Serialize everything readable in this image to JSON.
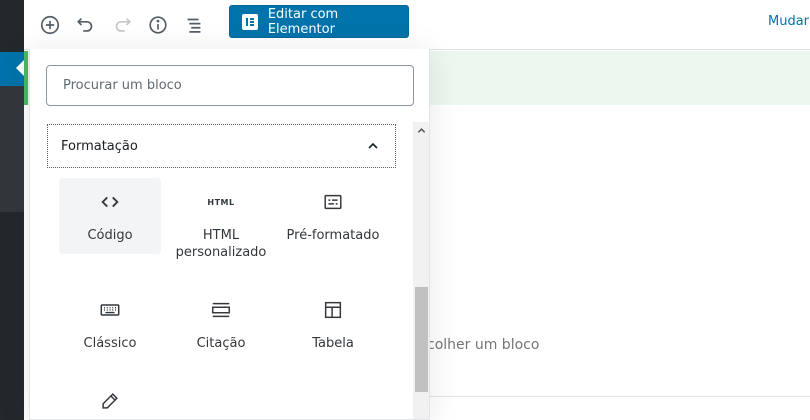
{
  "toolbar": {
    "add_icon": "plus-circle-icon",
    "undo_icon": "undo-icon",
    "redo_icon": "redo-icon",
    "info_icon": "info-icon",
    "outline_icon": "list-outline-icon",
    "elementor_label": "Editar com Elementor",
    "right_link": "Mudar"
  },
  "inserter": {
    "search_placeholder": "Procurar um bloco",
    "panel_title": "Formatação",
    "blocks": [
      {
        "label": "Código",
        "icon": "code-icon"
      },
      {
        "label": "HTML personalizado",
        "icon": "html-icon",
        "glyph": "HTML"
      },
      {
        "label": "Pré-formatado",
        "icon": "preformatted-icon"
      },
      {
        "label": "Clássico",
        "icon": "keyboard-icon"
      },
      {
        "label": "Citação",
        "icon": "pullquote-icon"
      },
      {
        "label": "Tabela",
        "icon": "table-icon"
      },
      {
        "label": "",
        "icon": "pencil-icon"
      }
    ]
  },
  "editor": {
    "placeholder_fragment": "colher um bloco"
  },
  "colors": {
    "primary": "#0073aa",
    "admin_dark": "#23282d",
    "notice_green": "#4ab866",
    "notice_bg": "#ecf7ed"
  }
}
